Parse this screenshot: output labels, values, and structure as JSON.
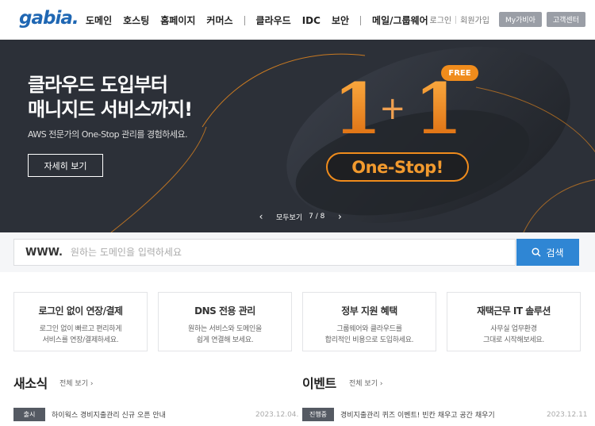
{
  "header": {
    "logo": "gabia.",
    "nav": [
      "도메인",
      "호스팅",
      "홈페이지",
      "커머스",
      "클라우드",
      "IDC",
      "보안",
      "메일/그룹웨어"
    ],
    "login": "로그인",
    "join": "회원가입",
    "mygabia": "My가비아",
    "support": "고객센터"
  },
  "banner": {
    "title_line1": "클라우드 도입부터",
    "title_line2": "매니지드 서비스까지!",
    "subtitle": "AWS 전문가의 One-Stop 관리를 경험하세요.",
    "button": "자세히 보기",
    "promo_big": "1+1",
    "free_badge": "FREE",
    "onestop": "One-Stop!",
    "pager_label": "모두보기",
    "pager_count": "7 / 8",
    "prev_icon": "chevron-left-icon",
    "next_icon": "chevron-right-icon"
  },
  "search": {
    "prefix": "www.",
    "placeholder": "원하는 도메인을 입력하세요",
    "button": "검색"
  },
  "cards": [
    {
      "title": "로그인 없이 연장/결제",
      "desc1": "로그인 없이 빠르고 편리하게",
      "desc2": "서비스를 연장/결제하세요."
    },
    {
      "title": "DNS 전용 관리",
      "desc1": "원하는 서비스와 도메인을",
      "desc2": "쉽게 연결해 보세요."
    },
    {
      "title": "정부 지원 혜택",
      "desc1": "그룹웨어와 클라우드를",
      "desc2": "합리적인 비용으로 도입하세요."
    },
    {
      "title": "재택근무 IT 솔루션",
      "desc1": "사무실 업무환경",
      "desc2": "그대로 시작해보세요."
    }
  ],
  "news": {
    "title": "새소식",
    "more": "전체 보기",
    "item": {
      "badge": "출시",
      "text": "하이웍스 경비지출관리 신규 오픈 안내",
      "date": "2023.12.04."
    }
  },
  "events": {
    "title": "이벤트",
    "more": "전체 보기",
    "item": {
      "badge": "진행중",
      "text": "경비지출관리 퀴즈 이벤트! 빈칸 채우고 공간 채우기",
      "date": "2023.12.11"
    }
  },
  "colors": {
    "brand": "#1f67b3",
    "banner_bg": "#2c3038",
    "accent_orange": "#f08c1c",
    "search_button": "#2f86d4"
  }
}
